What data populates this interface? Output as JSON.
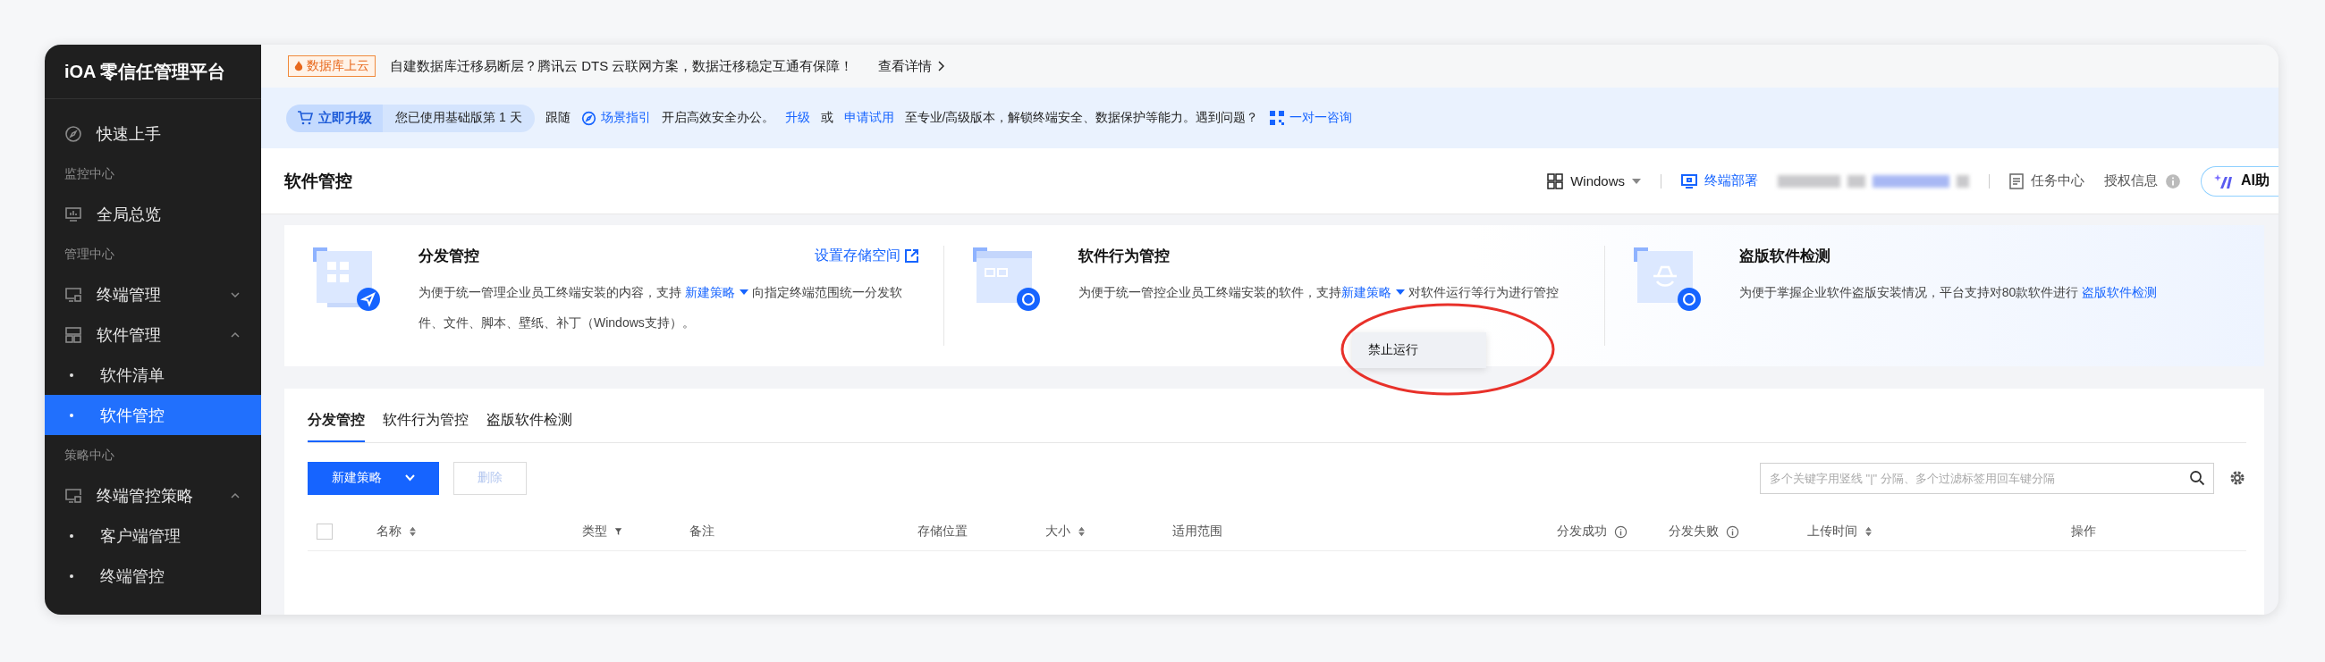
{
  "sidebar": {
    "brand": "iOA 零信任管理平台",
    "items": [
      {
        "kind": "item",
        "label": "快速上手",
        "selected": false
      },
      {
        "kind": "section",
        "label": "监控中心"
      },
      {
        "kind": "item",
        "label": "全局总览",
        "selected": false
      },
      {
        "kind": "section",
        "label": "管理中心"
      },
      {
        "kind": "item",
        "label": "终端管理",
        "selected": false,
        "expanded": false
      },
      {
        "kind": "item",
        "label": "软件管理",
        "selected": false,
        "expanded": true,
        "children": [
          {
            "label": "软件清单",
            "selected": false
          },
          {
            "label": "软件管控",
            "selected": true
          }
        ]
      },
      {
        "kind": "section",
        "label": "策略中心"
      },
      {
        "kind": "item",
        "label": "终端管控策略",
        "selected": false,
        "expanded": true,
        "children": [
          {
            "label": "客户端管理",
            "selected": false
          },
          {
            "label": "终端管控",
            "selected": false
          }
        ]
      }
    ]
  },
  "banner": {
    "tag": "数据库上云",
    "text": "自建数据库迁移易断层？腾讯云 DTS 云联网方案，数据迁移稳定互通有保障！",
    "link": "查看详情"
  },
  "upgrade_bar": {
    "button": "立即升级",
    "usage": "您已使用基础版第 1 天",
    "parts": [
      {
        "kind": "text",
        "text": "跟随"
      },
      {
        "kind": "guide-link",
        "text": "场景指引"
      },
      {
        "kind": "text",
        "text": "开启高效安全办公。"
      },
      {
        "kind": "link",
        "text": "升级"
      },
      {
        "kind": "text",
        "text": "或"
      },
      {
        "kind": "link",
        "text": "申请试用"
      },
      {
        "kind": "text",
        "text": "至专业/高级版本，解锁终端安全、数据保护等能力。遇到问题？"
      },
      {
        "kind": "consult-link",
        "text": "一对一咨询"
      }
    ]
  },
  "header": {
    "title": "软件管控",
    "os": "Windows",
    "deploy": "终端部署",
    "tasks": "任务中心",
    "license": "授权信息",
    "ai": "AI助"
  },
  "cards": [
    {
      "title": "分发管控",
      "link": "设置存储空间",
      "parts": [
        {
          "kind": "text",
          "text": "为便于统一管理企业员工终端安装的内容，支持 "
        },
        {
          "kind": "menu-link",
          "text": "新建策略"
        },
        {
          "kind": "text",
          "text": " 向指定终端范围统一分发软件、文件、脚本、壁纸、补丁（Windows支持）。"
        }
      ]
    },
    {
      "title": "软件行为管控",
      "parts": [
        {
          "kind": "text",
          "text": "为便于统一管控企业员工终端安装的软件，支持"
        },
        {
          "kind": "menu-link",
          "text": "新建策略"
        },
        {
          "kind": "text",
          "text": " 对软件运行等行为进行管控"
        }
      ]
    },
    {
      "title": "盗版软件检测",
      "parts": [
        {
          "kind": "text",
          "text": "为便于掌握企业软件盗版安装情况，平台支持对80款软件进行 "
        },
        {
          "kind": "link",
          "text": "盗版软件检测"
        }
      ]
    }
  ],
  "dropdown": {
    "items": [
      "禁止运行"
    ]
  },
  "tabs": [
    {
      "label": "分发管控",
      "selected": true
    },
    {
      "label": "软件行为管控",
      "selected": false
    },
    {
      "label": "盗版软件检测",
      "selected": false
    }
  ],
  "toolbar": {
    "new_button": "新建策略",
    "delete_button": {
      "label": "删除",
      "disabled": true
    },
    "search": {
      "placeholder": "多个关键字用竖线 \"|\" 分隔、多个过滤标签用回车键分隔"
    }
  },
  "table": {
    "select_all": {
      "checked": false
    },
    "columns": [
      {
        "kind": "sortable",
        "label": "名称"
      },
      {
        "kind": "filterable",
        "label": "类型"
      },
      {
        "kind": "plain",
        "label": "备注"
      },
      {
        "kind": "plain",
        "label": "存储位置"
      },
      {
        "kind": "sortable",
        "label": "大小"
      },
      {
        "kind": "plain",
        "label": "适用范围"
      },
      {
        "kind": "info",
        "label": "分发成功"
      },
      {
        "kind": "info",
        "label": "分发失败"
      },
      {
        "kind": "sortable",
        "label": "上传时间"
      },
      {
        "kind": "plain",
        "label": "操作"
      }
    ]
  }
}
